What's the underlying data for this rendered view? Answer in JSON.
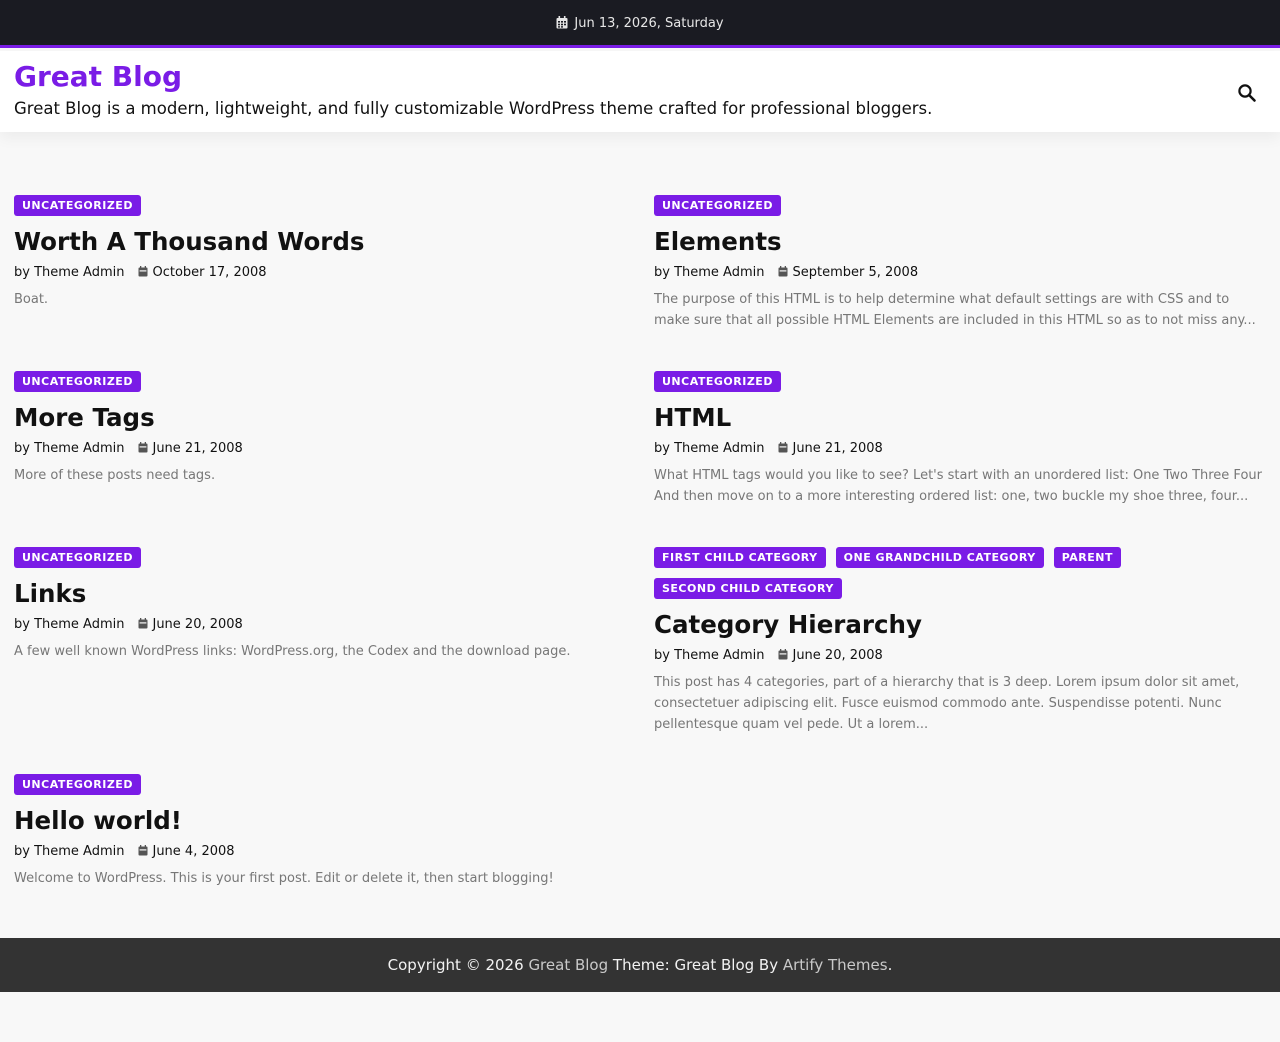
{
  "topbar": {
    "date": "Jun 13, 2026, Saturday",
    "icon": "calendar-icon"
  },
  "header": {
    "site_title": "Great Blog",
    "tagline": "Great Blog is a modern, lightweight, and fully customizable WordPress theme crafted for professional bloggers.",
    "search_icon": "search-icon"
  },
  "colors": {
    "accent": "#7a1ce6",
    "topbar_bg": "#1a1b22",
    "footer_bg": "#333333"
  },
  "posts": [
    {
      "categories": [
        "UNCATEGORIZED"
      ],
      "title": "Worth A Thousand Words",
      "author": "by Theme Admin",
      "date": "October 17, 2008",
      "excerpt": "Boat."
    },
    {
      "categories": [
        "UNCATEGORIZED"
      ],
      "title": "Elements",
      "author": "by Theme Admin",
      "date": "September 5, 2008",
      "excerpt": "The purpose of this HTML is to help determine what default settings are with CSS and to make sure that all possible HTML Elements are included in this HTML so as to not miss any..."
    },
    {
      "categories": [
        "UNCATEGORIZED"
      ],
      "title": "More Tags",
      "author": "by Theme Admin",
      "date": "June 21, 2008",
      "excerpt": "More of these posts need tags."
    },
    {
      "categories": [
        "UNCATEGORIZED"
      ],
      "title": "HTML",
      "author": "by Theme Admin",
      "date": "June 21, 2008",
      "excerpt": "What HTML tags would you like to see? Let's start with an unordered list: One Two Three Four And then move on to a more interesting ordered list: one, two buckle my shoe three, four..."
    },
    {
      "categories": [
        "UNCATEGORIZED"
      ],
      "title": "Links",
      "author": "by Theme Admin",
      "date": "June 20, 2008",
      "excerpt": "A few well known WordPress links: WordPress.org, the Codex and the download page."
    },
    {
      "categories": [
        "FIRST CHILD CATEGORY",
        "ONE GRANDCHILD CATEGORY",
        "PARENT",
        "SECOND CHILD CATEGORY"
      ],
      "title": "Category Hierarchy",
      "author": "by Theme Admin",
      "date": "June 20, 2008",
      "excerpt": "This post has 4 categories, part of a hierarchy that is 3 deep. Lorem ipsum dolor sit amet, consectetuer adipiscing elit. Fusce euismod commodo ante. Suspendisse potenti. Nunc pellentesque quam vel pede. Ut a lorem..."
    },
    {
      "categories": [
        "UNCATEGORIZED"
      ],
      "title": "Hello world!",
      "author": "by Theme Admin",
      "date": "June 4, 2008",
      "excerpt": "Welcome to WordPress. This is your first post. Edit or delete it, then start blogging!"
    }
  ],
  "footer": {
    "copyright": "Copyright © 2026",
    "site_link": "Great Blog",
    "theme_text": "Theme: Great Blog By",
    "author_link": "Artify Themes",
    "period": "."
  }
}
